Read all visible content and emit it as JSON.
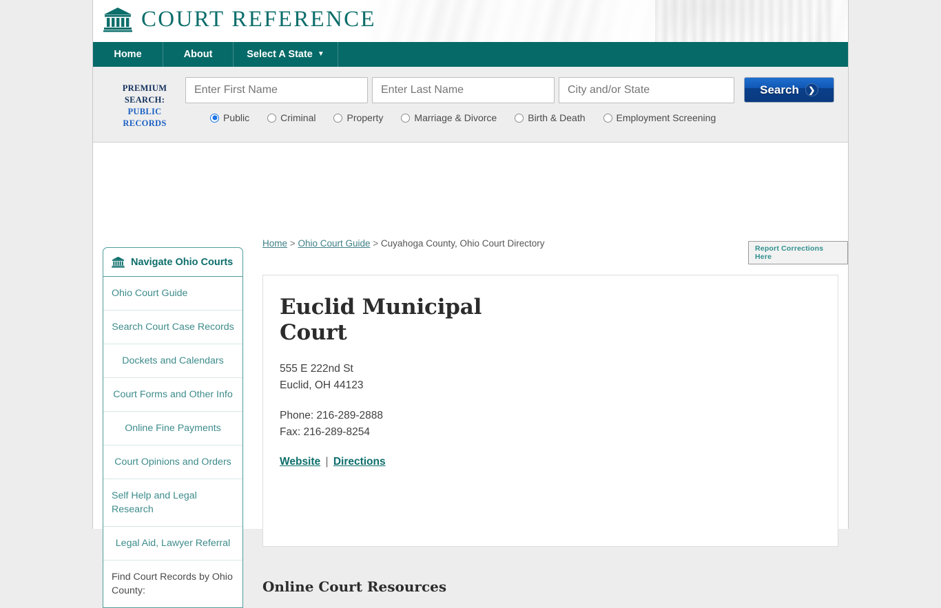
{
  "site": {
    "brand": "COURT REFERENCE",
    "brand_icon": "courthouse-icon",
    "brand_color": "#0c6e6b"
  },
  "nav": {
    "items": [
      {
        "label": "Home",
        "icon": null
      },
      {
        "label": "About",
        "icon": null
      },
      {
        "label": "Select A State",
        "icon": "chevron-down-icon"
      }
    ]
  },
  "premium_search": {
    "label_line1": "PREMIUM",
    "label_line2": "SEARCH:",
    "label_line3": "PUBLIC",
    "label_line4": "RECORDS",
    "first_name": {
      "placeholder": "Enter First Name",
      "value": ""
    },
    "last_name": {
      "placeholder": "Enter Last Name",
      "value": ""
    },
    "city_state": {
      "placeholder": "City and/or State",
      "value": ""
    },
    "search_button": "Search",
    "search_icon": "chevron-right-icon",
    "categories": [
      {
        "label": "Public",
        "selected": true
      },
      {
        "label": "Criminal",
        "selected": false
      },
      {
        "label": "Property",
        "selected": false
      },
      {
        "label": "Marriage & Divorce",
        "selected": false
      },
      {
        "label": "Birth & Death",
        "selected": false
      },
      {
        "label": "Employment Screening",
        "selected": false
      }
    ]
  },
  "breadcrumb": {
    "home": "Home",
    "sep1": ">",
    "guide": "Ohio Court Guide",
    "sep2": ">",
    "current": "Cuyahoga County, Ohio Court Directory"
  },
  "report_button": "Report Corrections Here",
  "sidebar": {
    "header": "Navigate Ohio Courts",
    "header_icon": "courthouse-icon",
    "items": [
      {
        "label": "Ohio Court Guide",
        "align": "left",
        "link": true
      },
      {
        "label": "Search Court Case Records",
        "align": "center",
        "link": true
      },
      {
        "label": "Dockets and Calendars",
        "align": "center",
        "link": true
      },
      {
        "label": "Court Forms and Other Info",
        "align": "center",
        "link": true
      },
      {
        "label": "Online Fine Payments",
        "align": "center",
        "link": true
      },
      {
        "label": "Court Opinions and Orders",
        "align": "center",
        "link": true
      },
      {
        "label": "Self Help and Legal Research",
        "align": "center",
        "link": true
      },
      {
        "label": "Legal Aid, Lawyer Referral",
        "align": "center",
        "link": true
      },
      {
        "label": "Find Court Records by Ohio County:",
        "align": "left",
        "link": false
      }
    ]
  },
  "court": {
    "title": "Euclid Municipal Court",
    "street": "555 E 222nd St",
    "city_state_zip": "Euclid, OH 44123",
    "phone": "Phone: 216-289-2888",
    "fax": "Fax: 216-289-8254",
    "website_link": "Website",
    "divider": "|",
    "directions_link": "Directions"
  },
  "resources": {
    "heading": "Online Court Resources"
  }
}
